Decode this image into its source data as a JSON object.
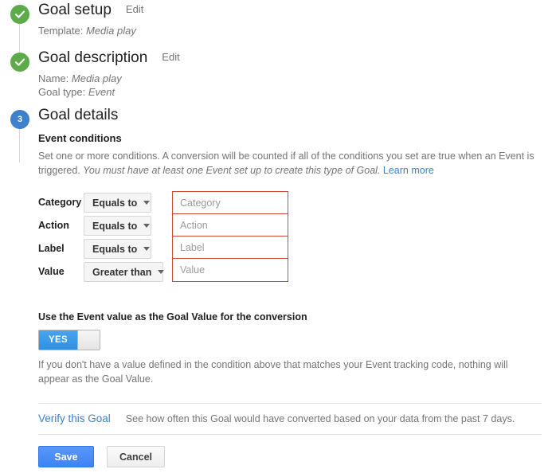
{
  "steps": [
    {
      "marker": "check-icon",
      "title": "Goal setup",
      "edit_label": "Edit",
      "sub_prefix": "Template: ",
      "sub_value": "Media play"
    },
    {
      "marker": "check-icon",
      "title": "Goal description",
      "edit_label": "Edit",
      "name_prefix": "Name: ",
      "name_value": "Media play",
      "type_prefix": "Goal type: ",
      "type_value": "Event"
    },
    {
      "marker": "3",
      "title": "Goal details"
    }
  ],
  "details": {
    "heading": "Event conditions",
    "description_part1": "Set one or more conditions. A conversion will be counted if all of the conditions you set are true when an Event is triggered. ",
    "description_italic": "You must have at least one Event set up to create this type of Goal.",
    "learn_more": "Learn more",
    "conditions": [
      {
        "label": "Category",
        "operator": "Equals to",
        "placeholder": "Category",
        "value": ""
      },
      {
        "label": "Action",
        "operator": "Equals to",
        "placeholder": "Action",
        "value": ""
      },
      {
        "label": "Label",
        "operator": "Equals to",
        "placeholder": "Label",
        "value": ""
      },
      {
        "label": "Value",
        "operator": "Greater than",
        "placeholder": "Value",
        "value": ""
      }
    ]
  },
  "toggle": {
    "heading": "Use the Event value as the Goal Value for the conversion",
    "state_label": "YES",
    "note": "If you don't have a value defined in the condition above that matches your Event tracking code, nothing will appear as the Goal Value."
  },
  "verify": {
    "link_label": "Verify this Goal",
    "note": "See how often this Goal would have converted based on your data from the past 7 days."
  },
  "actions": {
    "save_label": "Save",
    "cancel_label": "Cancel"
  },
  "colors": {
    "step_done": "#5cab49",
    "step_current": "#3d80cc",
    "link": "#3d80cc",
    "input_error_border": "#cf4a32",
    "toggle_on": "#3d9ae8",
    "save_button": "#4b8df8"
  }
}
